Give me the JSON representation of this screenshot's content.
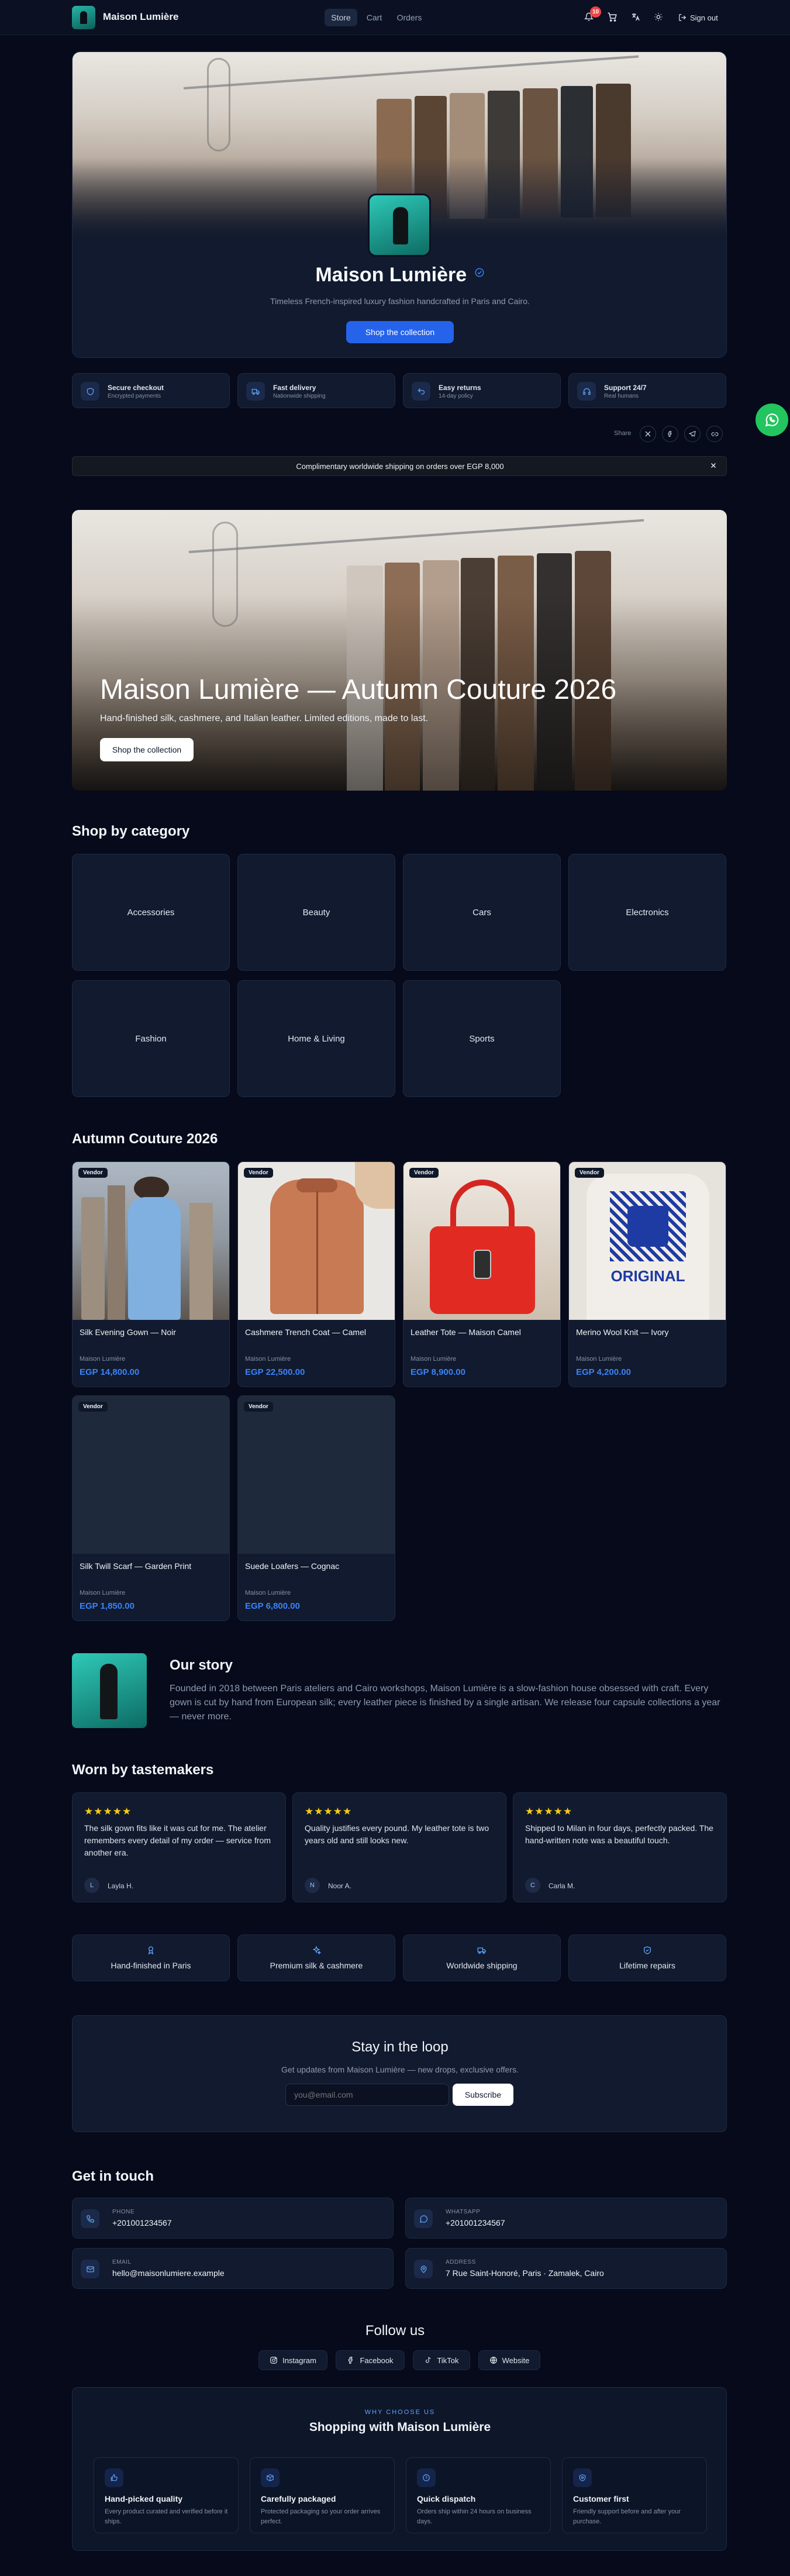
{
  "colors": {
    "accent": "#2563eb",
    "price": "#3b82f6",
    "star": "#facc15",
    "whatsapp": "#22c55e",
    "background": "#060a1a",
    "badge": "#ef4444"
  },
  "header": {
    "brand": "Maison Lumière",
    "nav": [
      {
        "label": "Store",
        "active": true
      },
      {
        "label": "Cart",
        "active": false
      },
      {
        "label": "Orders",
        "active": false
      }
    ],
    "notifications_count": "10",
    "icons": [
      "bell-icon",
      "cart-icon",
      "translate-icon",
      "sun-icon",
      "sign-out-icon"
    ],
    "sign_out": "Sign out"
  },
  "store": {
    "name": "Maison Lumière",
    "verified_icon": "check-badge-icon",
    "tagline": "Timeless French-inspired luxury fashion handcrafted in Paris and Cairo.",
    "cta": "Shop the collection"
  },
  "features": [
    {
      "icon": "shield-icon",
      "title": "Secure checkout",
      "sub": "Encrypted payments"
    },
    {
      "icon": "truck-icon",
      "title": "Fast delivery",
      "sub": "Nationwide shipping"
    },
    {
      "icon": "return-icon",
      "title": "Easy returns",
      "sub": "14-day policy"
    },
    {
      "icon": "headset-icon",
      "title": "Support 24/7",
      "sub": "Real humans"
    }
  ],
  "share": {
    "label": "Share",
    "icons": [
      "x-icon",
      "facebook-icon",
      "telegram-icon",
      "link-icon"
    ]
  },
  "announcement": "Complimentary worldwide shipping on orders over EGP 8,000",
  "hero": {
    "title": "Maison Lumière — Autumn Couture 2026",
    "subtitle": "Hand-finished silk, cashmere, and Italian leather. Limited editions, made to last.",
    "cta": "Shop the collection"
  },
  "categories": {
    "heading": "Shop by category",
    "items": [
      "Accessories",
      "Beauty",
      "Cars",
      "Electronics",
      "Fashion",
      "Home & Living",
      "Sports"
    ]
  },
  "collection": {
    "heading": "Autumn Couture 2026",
    "products": [
      {
        "badge": "Vendor",
        "name": "Silk Evening Gown — Noir",
        "vendor": "Maison Lumière",
        "price": "EGP 14,800.00"
      },
      {
        "badge": "Vendor",
        "name": "Cashmere Trench Coat — Camel",
        "vendor": "Maison Lumière",
        "price": "EGP 22,500.00"
      },
      {
        "badge": "Vendor",
        "name": "Leather Tote — Maison Camel",
        "vendor": "Maison Lumière",
        "price": "EGP 8,900.00"
      },
      {
        "badge": "Vendor",
        "name": "Merino Wool Knit — Ivory",
        "vendor": "Maison Lumière",
        "price": "EGP 4,200.00"
      },
      {
        "badge": "Vendor",
        "name": "Silk Twill Scarf — Garden Print",
        "vendor": "Maison Lumière",
        "price": "EGP 1,850.00"
      },
      {
        "badge": "Vendor",
        "name": "Suede Loafers — Cognac",
        "vendor": "Maison Lumière",
        "price": "EGP 6,800.00"
      }
    ],
    "tshirt_print": "ORIGINAL"
  },
  "story": {
    "heading": "Our story",
    "text": "Founded in 2018 between Paris ateliers and Cairo workshops, Maison Lumière is a slow-fashion house obsessed with craft. Every gown is cut by hand from European silk; every leather piece is finished by a single artisan. We release four capsule collections a year — never more."
  },
  "testimonials": {
    "heading": "Worn by tastemakers",
    "items": [
      {
        "stars": "★★★★★",
        "text": "The silk gown fits like it was cut for me. The atelier remembers every detail of my order — service from another era.",
        "initial": "L",
        "author": "Layla H."
      },
      {
        "stars": "★★★★★",
        "text": "Quality justifies every pound. My leather tote is two years old and still looks new.",
        "initial": "N",
        "author": "Noor A."
      },
      {
        "stars": "★★★★★",
        "text": "Shipped to Milan in four days, perfectly packed. The hand-written note was a beautiful touch.",
        "initial": "C",
        "author": "Carla M."
      }
    ]
  },
  "values": [
    {
      "icon": "ribbon-icon",
      "label": "Hand-finished in Paris"
    },
    {
      "icon": "sparkles-icon",
      "label": "Premium silk & cashmere"
    },
    {
      "icon": "truck-icon",
      "label": "Worldwide shipping"
    },
    {
      "icon": "shield-icon",
      "label": "Lifetime repairs"
    }
  ],
  "newsletter": {
    "title": "Stay in the loop",
    "sub": "Get updates from Maison Lumière — new drops, exclusive offers.",
    "placeholder": "you@email.com",
    "button": "Subscribe"
  },
  "contact": {
    "heading": "Get in touch",
    "items": [
      {
        "icon": "phone-icon",
        "label": "PHONE",
        "value": "+201001234567"
      },
      {
        "icon": "whatsapp-icon",
        "label": "WHATSAPP",
        "value": "+201001234567"
      },
      {
        "icon": "mail-icon",
        "label": "EMAIL",
        "value": "hello@maisonlumiere.example"
      },
      {
        "icon": "map-pin-icon",
        "label": "ADDRESS",
        "value": "7 Rue Saint-Honoré, Paris · Zamalek, Cairo"
      }
    ]
  },
  "follow": {
    "heading": "Follow us",
    "links": [
      {
        "icon": "instagram-icon",
        "label": "Instagram"
      },
      {
        "icon": "facebook-icon",
        "label": "Facebook"
      },
      {
        "icon": "tiktok-icon",
        "label": "TikTok"
      },
      {
        "icon": "globe-icon",
        "label": "Website"
      }
    ]
  },
  "why": {
    "kicker": "WHY CHOOSE US",
    "title": "Shopping with Maison Lumière",
    "items": [
      {
        "icon": "thumb-icon",
        "title": "Hand-picked quality",
        "sub": "Every product curated and verified before it ships."
      },
      {
        "icon": "box-icon",
        "title": "Carefully packaged",
        "sub": "Protected packaging so your order arrives perfect."
      },
      {
        "icon": "clock-icon",
        "title": "Quick dispatch",
        "sub": "Orders ship within 24 hours on business days."
      },
      {
        "icon": "heart-shield-icon",
        "title": "Customer first",
        "sub": "Friendly support before and after your purchase."
      }
    ]
  }
}
